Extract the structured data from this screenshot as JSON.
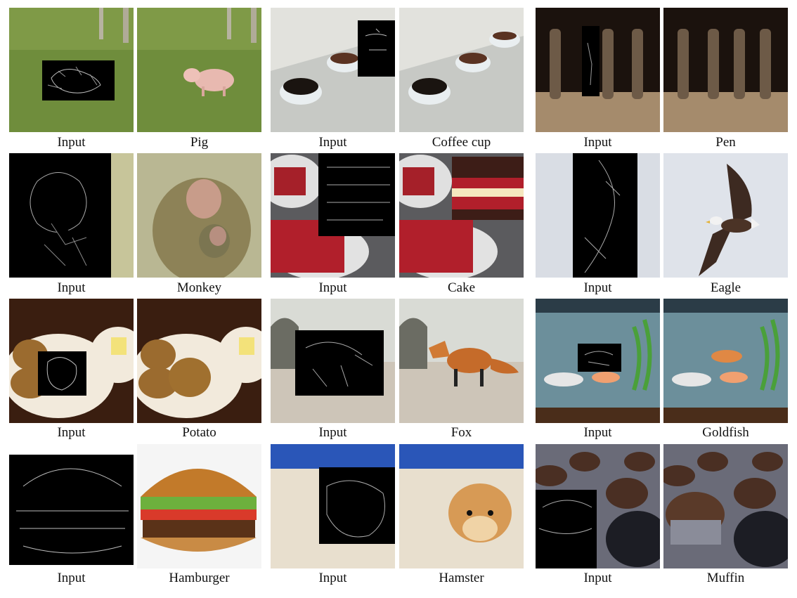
{
  "captions": {
    "input": "Input",
    "pig": "Pig",
    "coffee_cup": "Coffee cup",
    "pen": "Pen",
    "monkey": "Monkey",
    "cake": "Cake",
    "eagle": "Eagle",
    "potato": "Potato",
    "fox": "Fox",
    "goldfish": "Goldfish",
    "hamburger": "Hamburger",
    "hamster": "Hamster",
    "muffin": "Muffin"
  }
}
